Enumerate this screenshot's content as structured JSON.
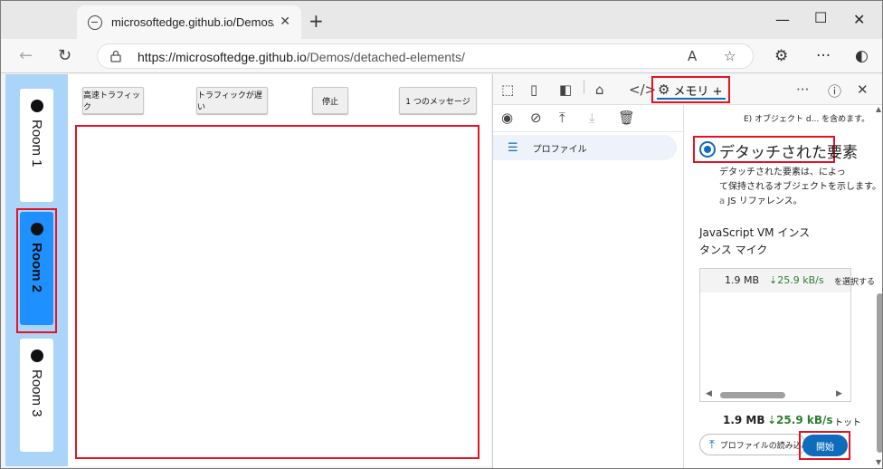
{
  "browser": {
    "tab_title": "microsoftedge.github.io/Demos/d",
    "url_origin": "https://microsoftedge.github.io",
    "url_path": "/Demos/detached-elements/",
    "read_aloud_label": "A",
    "new_tab_label": "+",
    "more_label": "···"
  },
  "rooms": [
    {
      "label": "Room 1",
      "active": false
    },
    {
      "label": "Room 2",
      "active": true
    },
    {
      "label": "Room 3",
      "active": false
    }
  ],
  "actions": {
    "fast_traffic": "高速トラフィック",
    "slow_traffic": "トラフィックが遅い",
    "stop": "停止",
    "one_message": "1 つのメッセージ"
  },
  "devtools": {
    "memory_tab_label": "メモリ +",
    "sidebar_item": "プロファイル",
    "truncated_line": "E)  オブジェクト d... を含めます。",
    "radio_label": "デタッチされた要素",
    "radio_desc_1": "デタッチされた要素は、によっ",
    "radio_desc_2": "て保持されるオブジェクトを示します。",
    "radio_desc_3a": "a",
    "radio_desc_3b": "JS リファレンス。",
    "vm_title_1": "JavaScript VM インス",
    "vm_title_2": "タンス マイク",
    "vm_row_size": "1.9 MB",
    "vm_row_rate": "⇣25.9 kB/s",
    "vm_row_select": "を選択する",
    "total_size": "1.9 MB",
    "total_rate": "⇣25.9 kB/s",
    "total_label": "トット",
    "load_profile": "プロファイルの読み込み",
    "start": "開始"
  },
  "colors": {
    "accent": "#0f6cbd",
    "highlight": "#e81123",
    "room_active": "#1e90ff",
    "rooms_bg": "#aad4f8",
    "rate_green": "#2e7d32"
  }
}
